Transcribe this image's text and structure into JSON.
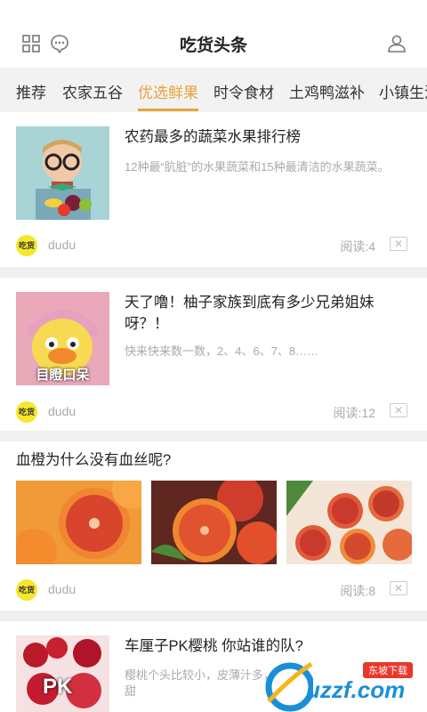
{
  "header": {
    "title": "吃货头条"
  },
  "tabs": [
    {
      "label": "推荐"
    },
    {
      "label": "农家五谷"
    },
    {
      "label": "优选鲜果"
    },
    {
      "label": "时令食材"
    },
    {
      "label": "土鸡鸭滋补"
    },
    {
      "label": "小镇生活"
    }
  ],
  "active_tab": "优选鲜果",
  "articles": [
    {
      "title": "农药最多的蔬菜水果排行榜",
      "summary": "12种最“肮脏”的水果蔬菜和15种最清洁的水果蔬菜。",
      "source_logo": "吃货",
      "source": "dudu",
      "reads": "阅读:4"
    },
    {
      "title": "天了噜！柚子家族到底有多少兄弟姐妹呀？！",
      "summary": "快来快来数一数，2、4、6、7、8……",
      "image_caption": "目瞪口呆",
      "source_logo": "吃货",
      "source": "dudu",
      "reads": "阅读:12"
    },
    {
      "title": "血橙为什么没有血丝呢?",
      "source_logo": "吃货",
      "source": "dudu",
      "reads": "阅读:8"
    },
    {
      "title": "车厘子PK樱桃 你站谁的队?",
      "summary": "樱桃个头比较小，皮薄汁多，甜",
      "image_caption": "PK"
    }
  ],
  "close_glyph": "✕",
  "watermark": {
    "text": "uzzf.com",
    "badge": "东坡下载"
  },
  "colors": {
    "accent": "#e9a23b",
    "logo_yellow": "#f5e82a",
    "orange": "#f4902a",
    "blood_orange": "#d94a2c"
  }
}
